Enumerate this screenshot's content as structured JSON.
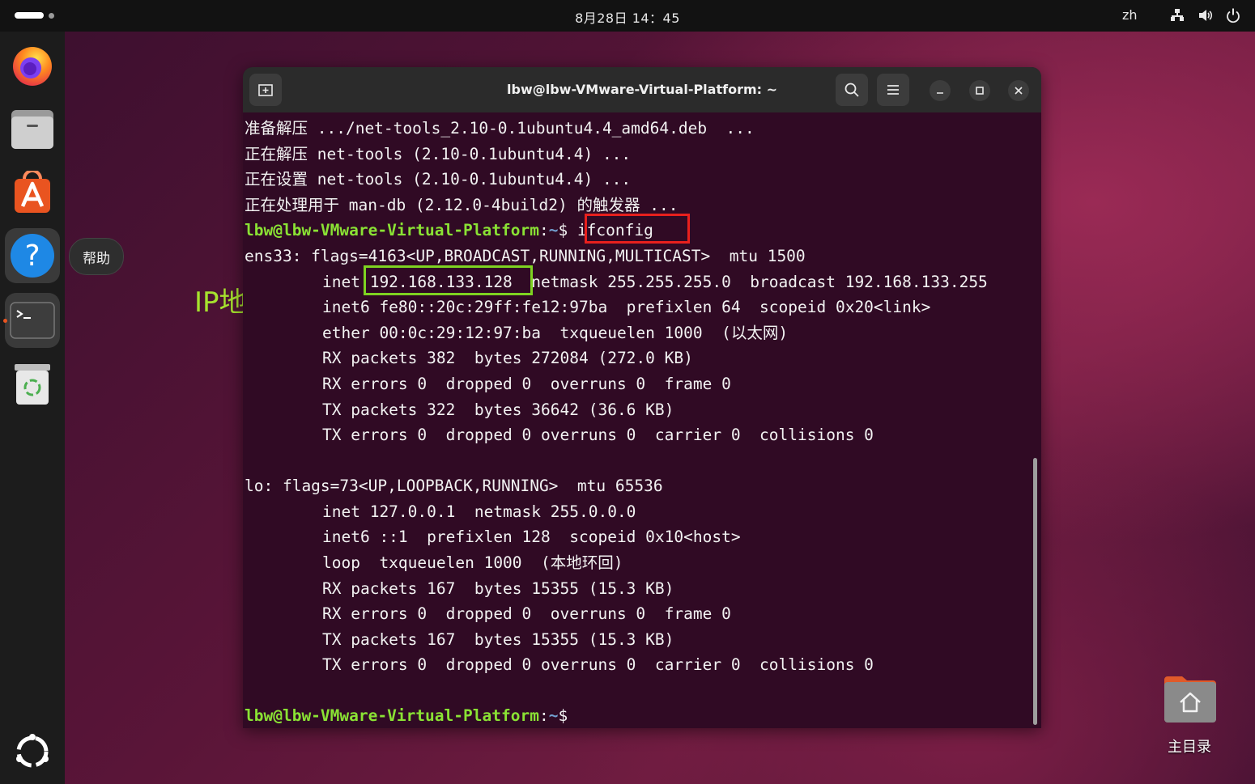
{
  "topbar": {
    "clock": "8月28日 14：45",
    "lang": "zh"
  },
  "dock": {
    "apps": [
      {
        "name": "firefox",
        "icon": "firefox-icon"
      },
      {
        "name": "files",
        "icon": "files-icon"
      },
      {
        "name": "app-center",
        "icon": "app-center-icon"
      },
      {
        "name": "help",
        "icon": "help-icon"
      },
      {
        "name": "terminal",
        "icon": "terminal-icon"
      },
      {
        "name": "trash",
        "icon": "trash-icon"
      }
    ],
    "tooltip": "帮助"
  },
  "annotation": {
    "ip_label": "IP地址"
  },
  "terminal": {
    "title": "lbw@lbw-VMware-Virtual-Platform: ~",
    "prompt_user": "lbw@lbw-VMware-Virtual-Platform",
    "prompt_path": "~",
    "lines": [
      "准备解压 .../net-tools_2.10-0.1ubuntu4.4_amd64.deb  ...",
      "正在解压 net-tools (2.10-0.1ubuntu4.4) ...",
      "正在设置 net-tools (2.10-0.1ubuntu4.4) ...",
      "正在处理用于 man-db (2.12.0-4build2) 的触发器 ...",
      "ifconfig",
      "ens33: flags=4163<UP,BROADCAST,RUNNING,MULTICAST>  mtu 1500",
      "inet 192.168.133.128  netmask 255.255.255.0  broadcast 192.168.133.255",
      "inet6 fe80::20c:29ff:fe12:97ba  prefixlen 64  scopeid 0x20<link>",
      "ether 00:0c:29:12:97:ba  txqueuelen 1000  (以太网)",
      "RX packets 382  bytes 272084 (272.0 KB)",
      "RX errors 0  dropped 0  overruns 0  frame 0",
      "TX packets 322  bytes 36642 (36.6 KB)",
      "TX errors 0  dropped 0 overruns 0  carrier 0  collisions 0",
      "lo: flags=73<UP,LOOPBACK,RUNNING>  mtu 65536",
      "inet 127.0.0.1  netmask 255.0.0.0",
      "inet6 ::1  prefixlen 128  scopeid 0x10<host>",
      "loop  txqueuelen 1000  (本地环回)",
      "RX packets 167  bytes 15355 (15.3 KB)",
      "RX errors 0  dropped 0  overruns 0  frame 0",
      "TX packets 167  bytes 15355 (15.3 KB)",
      "TX errors 0  dropped 0 overruns 0  carrier 0  collisions 0"
    ]
  },
  "desktop": {
    "home_label": "主目录"
  },
  "colors": {
    "terminal_bg": "#300a24",
    "prompt_user": "#8ae234",
    "prompt_path": "#729fcf",
    "highlight_cmd": "#e8201d",
    "highlight_ip": "#7ed321"
  }
}
